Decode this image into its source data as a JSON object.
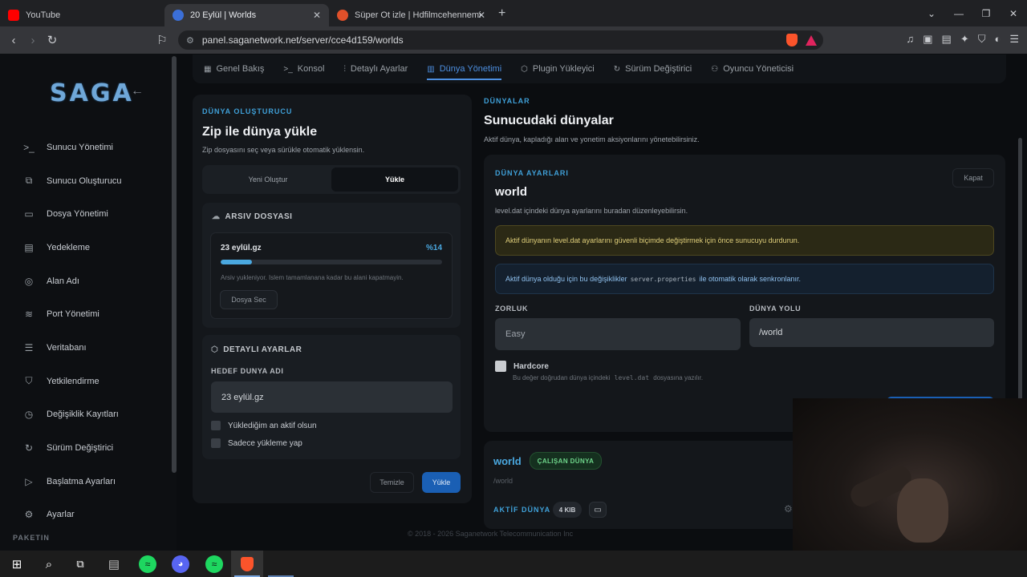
{
  "browser": {
    "tabs": [
      {
        "title": "YouTube",
        "favicon_color": "#ff0000"
      },
      {
        "title": "20 Eylül | Worlds",
        "favicon_color": "#3b6fd8"
      },
      {
        "title": "Süper Ot izle | Hdfilmcehennemi | Film",
        "favicon_color": "#e0502a"
      }
    ],
    "url": "panel.saganetwork.net/server/cce4d159/worlds"
  },
  "sidebar": {
    "logo": "SAGA",
    "items": [
      {
        "label": "Sunucu Yönetimi",
        "icon": ">_"
      },
      {
        "label": "Sunucu Oluşturucu",
        "icon": "⧉"
      },
      {
        "label": "Dosya Yönetimi",
        "icon": "▭"
      },
      {
        "label": "Yedekleme",
        "icon": "▤"
      },
      {
        "label": "Alan Adı",
        "icon": "◎"
      },
      {
        "label": "Port Yönetimi",
        "icon": "≋"
      },
      {
        "label": "Veritabanı",
        "icon": "☰"
      },
      {
        "label": "Yetkilendirme",
        "icon": "⛉"
      },
      {
        "label": "Değişiklik Kayıtları",
        "icon": "◷"
      },
      {
        "label": "Sürüm Değiştirici",
        "icon": "↻"
      },
      {
        "label": "Başlatma Ayarları",
        "icon": "▷"
      },
      {
        "label": "Ayarlar",
        "icon": "⚙"
      }
    ],
    "section_label": "PAKETIN"
  },
  "top_tabs": [
    {
      "label": "Genel Bakış",
      "icon": "▦"
    },
    {
      "label": "Konsol",
      "icon": ">_"
    },
    {
      "label": "Detaylı Ayarlar",
      "icon": "⫶"
    },
    {
      "label": "Dünya Yönetimi",
      "icon": "▥"
    },
    {
      "label": "Plugin Yükleyici",
      "icon": "⬡"
    },
    {
      "label": "Sürüm Değiştirici",
      "icon": "↻"
    },
    {
      "label": "Oyuncu Yöneticisi",
      "icon": "⚇"
    }
  ],
  "creator": {
    "eyebrow": "DÜNYA OLUŞTURUCU",
    "title": "Zip ile dünya yükle",
    "subtitle": "Zip dosyasını seç veya sürükle otomatik yüklensin.",
    "segments": [
      "Yeni Oluştur",
      "Yükle"
    ],
    "archive": {
      "heading": "ARSIV DOSYASI",
      "file_name": "23 eylül.gz",
      "percent_label": "%14",
      "progress": 0.14,
      "note": "Arsiv yukleniyor. Islem tamamlanana kadar bu alani kapatmayin.",
      "choose_button": "Dosya Sec"
    },
    "advanced": {
      "heading": "DETAYLI AYARLAR",
      "target_label": "HEDEF DUNYA ADI",
      "target_value": "23 eylül.gz",
      "checkbox_active": "Yüklediğim an aktif olsun",
      "checkbox_upload_only": "Sadece yükleme yap"
    },
    "clear_button": "Temizle",
    "upload_button": "Yükle"
  },
  "worlds": {
    "eyebrow": "DÜNYALAR",
    "title": "Sunucudaki dünyalar",
    "subtitle": "Aktif dünya, kapladığı alan ve yonetim aksiyonlarını yönetebilirsiniz."
  },
  "settings": {
    "eyebrow": "DÜNYA AYARLARI",
    "close_button": "Kapat",
    "world_name": "world",
    "description": "level.dat içindeki dünya ayarlarını buradan düzenleyebilirsin.",
    "warning": "Aktif dünyanın level.dat ayarlarını güvenli biçimde değiştirmek için önce sunucuyu durdurun.",
    "info_pre": "Aktif dünya olduğu için bu değişiklikler",
    "info_code": "server.properties",
    "info_post": "ile otomatik olarak senkronlanır.",
    "difficulty_label": "ZORLUK",
    "difficulty_value": "Easy",
    "path_label": "DÜNYA YOLU",
    "path_value": "/world",
    "hardcore_label": "Hardcore",
    "hardcore_note_pre": "Bu değer doğrudan dünya içindeki",
    "hardcore_note_code": "level.dat",
    "hardcore_note_post": "dosyasına yazılır."
  },
  "world_card": {
    "name": "world",
    "status_badge": "ÇALIŞAN DÜNYA",
    "path": "/world",
    "active_label": "AKTİF DÜNYA",
    "size": "4 KIB"
  },
  "footer": "© 2018 - 2026 Saganetwork Telecommunication Inc",
  "colors": {
    "accent": "#4d8fe0",
    "eyebrow": "#3fa0d8",
    "success": "#6fd68b",
    "warning": "#e0cf7a"
  }
}
